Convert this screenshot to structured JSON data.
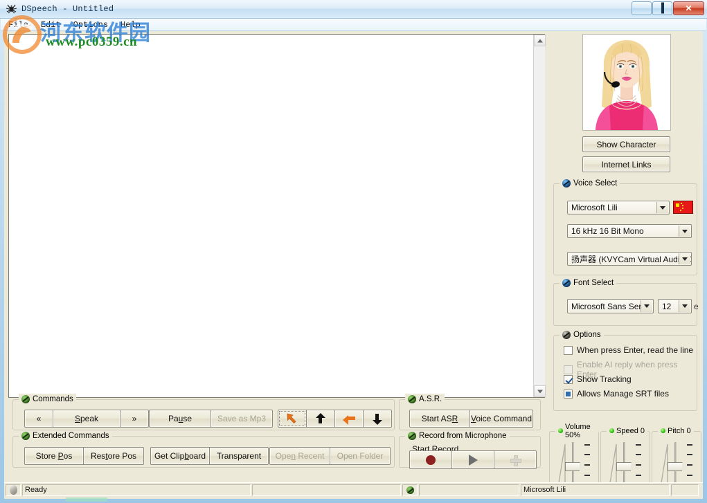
{
  "window": {
    "title": "DSpeech - Untitled",
    "app_icon": "spider-icon",
    "buttons": {
      "minimize": "minimize-icon",
      "maximize": "maximize-icon",
      "close": "close-icon"
    }
  },
  "menubar": {
    "items": [
      "File",
      "Edit",
      "Options",
      "Help"
    ]
  },
  "editor": {
    "text": "",
    "placeholder": ""
  },
  "watermark": {
    "cn_text": "河东软件园",
    "url": "www.pc0359.cn"
  },
  "right_panel": {
    "character_alt": "blonde-woman-with-headset",
    "show_character": "Show Character",
    "internet_links": "Internet Links",
    "voice_select": {
      "title": "Voice Select",
      "voice": "Microsoft Lili",
      "flag": "china-flag-icon",
      "format": "16 kHz 16 Bit Mono",
      "device": "扬声器 (KVYCam Virtual Audio C"
    },
    "font_select": {
      "title": "Font Select",
      "font_name": "Microsoft Sans Serif",
      "font_size": "12",
      "ghost": "e"
    },
    "options": {
      "title": "Options",
      "items": [
        {
          "label": "When press Enter, read the line",
          "state": "unchecked",
          "enabled": true
        },
        {
          "label": "Enable AI reply when press Enter",
          "state": "unchecked",
          "enabled": false
        },
        {
          "label": "Show Tracking",
          "state": "checked",
          "enabled": true
        },
        {
          "label": "Allows Manage SRT files",
          "state": "filled",
          "enabled": true
        }
      ]
    }
  },
  "commands": {
    "title": "Commands",
    "prev": "«",
    "speak": "Speak",
    "next": "»",
    "pause": "Pause",
    "save_as_mp3": "Save as Mp3",
    "arrows": [
      "nw-arrow-icon",
      "up-arrow-icon",
      "left-arrow-icon",
      "down-arrow-icon"
    ]
  },
  "extended_commands": {
    "title": "Extended Commands",
    "store_pos": "Store Pos",
    "restore_pos": "Restore Pos",
    "get_clipboard": "Get Clipboard",
    "transparent": "Transparent",
    "open_recent": "Open Recent",
    "open_folder": "Open Folder"
  },
  "asr": {
    "title": "A.S.R.",
    "start_asr": "Start ASR",
    "voice_command": "Voice Command"
  },
  "record": {
    "title": "Record from Microphone",
    "start_record_label": "Start Record",
    "record_icon": "record-circle-icon",
    "play_icon": "play-triangle-icon",
    "add_icon": "plus-icon"
  },
  "sliders": [
    {
      "name": "volume",
      "label": "Volume 50%",
      "value": 50
    },
    {
      "name": "speed",
      "label": "Speed 0",
      "value": 0
    },
    {
      "name": "pitch",
      "label": "Pitch 0",
      "value": 0
    }
  ],
  "statusbar": {
    "icon": "egg-icon",
    "ready": "Ready",
    "panel2": "",
    "panel3_icon": "green-ball-icon",
    "panel4": "",
    "voice": "Microsoft Lili",
    "panel6": ""
  },
  "colors": {
    "face": "#ece9d8",
    "accent_orange": "#e8731a",
    "flag_red": "#e81818",
    "green": "#1d8b23",
    "title_blue": "#2d7fd6"
  }
}
